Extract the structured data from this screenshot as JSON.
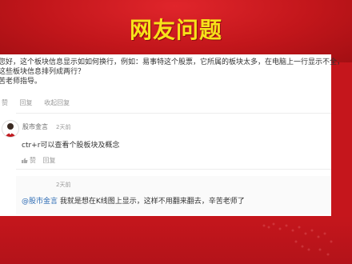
{
  "banner": {
    "title": "网友问题"
  },
  "question": {
    "lines": [
      "您好，这个板块信息显示如如何换行，例如：易事特这个股票，它所属的板块太多，在电脑上一行显示不全，",
      "这些板块信息排列成两行？",
      "苦老师指导。"
    ],
    "actions": {
      "like": "赞",
      "reply": "回复",
      "collapse": "收起回复"
    }
  },
  "reply1": {
    "user": "股市金言",
    "time": "2天前",
    "text": "ctr+r可以查看个股板块及概念",
    "like": "赞",
    "reply": "回复"
  },
  "reply2": {
    "time": "2天前",
    "mention": "@股市金言",
    "text": "我就是想在K线图上显示，这样不用翻来翻去，辛苦老师了"
  },
  "colors": {
    "banner_red": "#c5161c",
    "title_yellow": "#f7e21a",
    "mention_blue": "#2f6db5"
  }
}
